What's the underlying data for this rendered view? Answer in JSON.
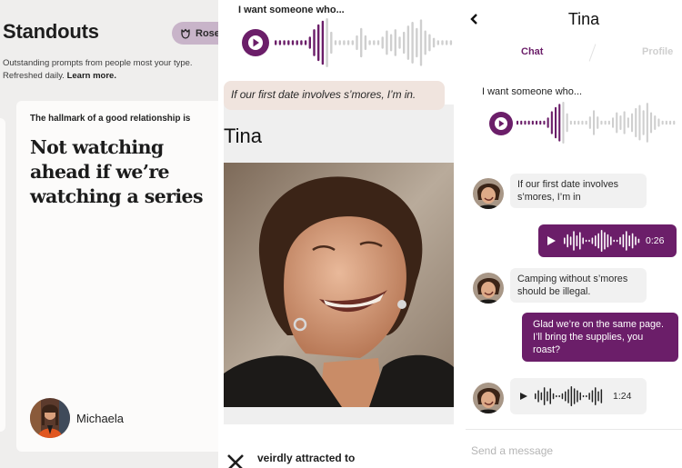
{
  "colors": {
    "brand": "#6b1e69",
    "wave_inactive": "#cfcfcf",
    "rose_pill": "#c8b4c9",
    "quote_bg": "#f0e4de",
    "incoming_bubble": "#f1f1f1"
  },
  "standouts": {
    "title": "Standouts",
    "rose_button": {
      "icon": "rose-icon",
      "label": "Rose"
    },
    "subtitle": "Outstanding prompts from people most your type. Refreshed daily.",
    "learn_more": "Learn more.",
    "card": {
      "prompt": "The hallmark of a good relationship is",
      "answer": "Not watching ahead if we’re watching a series",
      "user_name": "Michaela",
      "avatar": "michaela-avatar"
    }
  },
  "profile": {
    "voice_prompt": {
      "label": "I want someone who...",
      "play_icon": "play-icon",
      "progress_fraction": 0.2
    },
    "quote": "If our first date involves s’mores, I’m in.",
    "name": "Tina",
    "photo": "tina-photo",
    "next_prompt_partial": "veirdly attracted to",
    "skip_icon": "close-icon"
  },
  "chat": {
    "back_icon": "chevron-left-icon",
    "title": "Tina",
    "tabs": [
      {
        "label": "Chat",
        "active": true
      },
      {
        "label": "Profile",
        "active": false
      }
    ],
    "voice_prompt": {
      "label": "I want someone who...",
      "progress_fraction": 0.2
    },
    "messages": [
      {
        "direction": "in",
        "type": "text",
        "text": "If our first date involves s’mores, I’m in"
      },
      {
        "direction": "out",
        "type": "voice",
        "duration": "0:26"
      },
      {
        "direction": "in",
        "type": "text",
        "text": "Camping without s’mores should be illegal."
      },
      {
        "direction": "out",
        "type": "text",
        "text": "Glad we’re on the same page. I’ll bring the supplies, you roast?"
      },
      {
        "direction": "in",
        "type": "voice",
        "duration": "1:24"
      }
    ],
    "composer_placeholder": "Send a message"
  }
}
